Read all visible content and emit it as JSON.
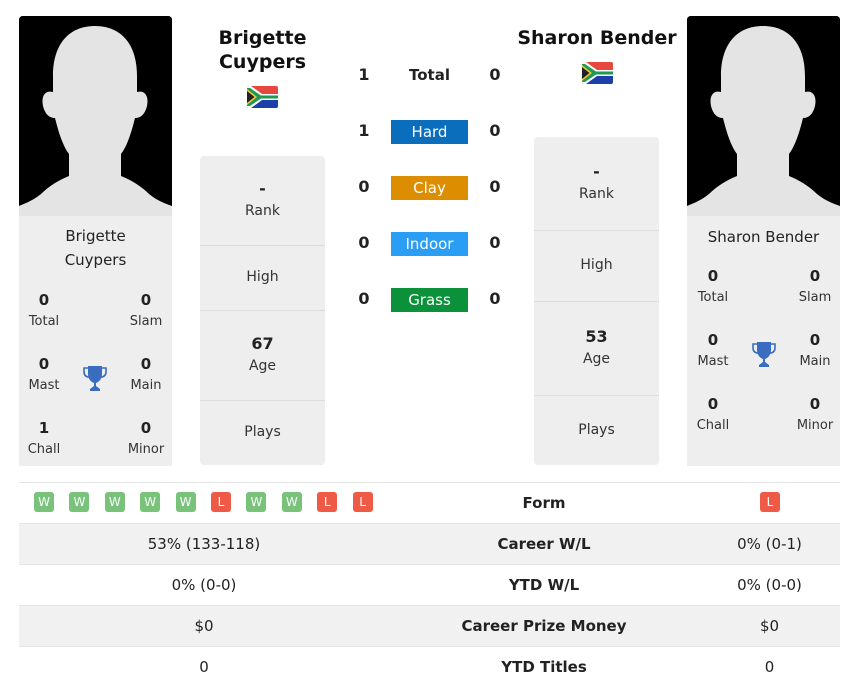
{
  "player1": {
    "name": "Brigette Cuypers",
    "name_line1": "Brigette",
    "name_line2": "Cuypers",
    "country_flag": "south-africa-flag-icon",
    "titles": {
      "total": {
        "value": "0",
        "label": "Total"
      },
      "slam": {
        "value": "0",
        "label": "Slam"
      },
      "mast": {
        "value": "0",
        "label": "Mast"
      },
      "main": {
        "value": "0",
        "label": "Main"
      },
      "chall": {
        "value": "1",
        "label": "Chall"
      },
      "minor": {
        "value": "0",
        "label": "Minor"
      }
    },
    "info": {
      "rank": {
        "value": "-",
        "label": "Rank"
      },
      "high": {
        "value": "",
        "label": "High"
      },
      "age": {
        "value": "67",
        "label": "Age"
      },
      "plays": {
        "value": "",
        "label": "Plays"
      }
    },
    "form": [
      "W",
      "W",
      "W",
      "W",
      "W",
      "L",
      "W",
      "W",
      "L",
      "L"
    ],
    "career_wl": "53% (133-118)",
    "ytd_wl": "0% (0-0)",
    "career_prize": "$0",
    "ytd_titles": "0"
  },
  "player2": {
    "name": "Sharon Bender",
    "country_flag": "south-africa-flag-icon",
    "titles": {
      "total": {
        "value": "0",
        "label": "Total"
      },
      "slam": {
        "value": "0",
        "label": "Slam"
      },
      "mast": {
        "value": "0",
        "label": "Mast"
      },
      "main": {
        "value": "0",
        "label": "Main"
      },
      "chall": {
        "value": "0",
        "label": "Chall"
      },
      "minor": {
        "value": "0",
        "label": "Minor"
      }
    },
    "info": {
      "rank": {
        "value": "-",
        "label": "Rank"
      },
      "high": {
        "value": "",
        "label": "High"
      },
      "age": {
        "value": "53",
        "label": "Age"
      },
      "plays": {
        "value": "",
        "label": "Plays"
      }
    },
    "form": [
      "L"
    ],
    "career_wl": "0% (0-1)",
    "ytd_wl": "0% (0-0)",
    "career_prize": "$0",
    "ytd_titles": "0"
  },
  "h2h": [
    {
      "label": "Total",
      "p1": "1",
      "p2": "0",
      "color": ""
    },
    {
      "label": "Hard",
      "p1": "1",
      "p2": "0",
      "color": "#0a6ebd"
    },
    {
      "label": "Clay",
      "p1": "0",
      "p2": "0",
      "color": "#dd8d00"
    },
    {
      "label": "Indoor",
      "p1": "0",
      "p2": "0",
      "color": "#2a9df4"
    },
    {
      "label": "Grass",
      "p1": "0",
      "p2": "0",
      "color": "#0a9139"
    }
  ],
  "table": {
    "form_label": "Form",
    "career_wl_label": "Career W/L",
    "ytd_wl_label": "YTD W/L",
    "career_prize_label": "Career Prize Money",
    "ytd_titles_label": "YTD Titles"
  },
  "colors": {
    "win": "#78c27a",
    "loss": "#ee5a45",
    "trophy": "#3a6cbf"
  }
}
